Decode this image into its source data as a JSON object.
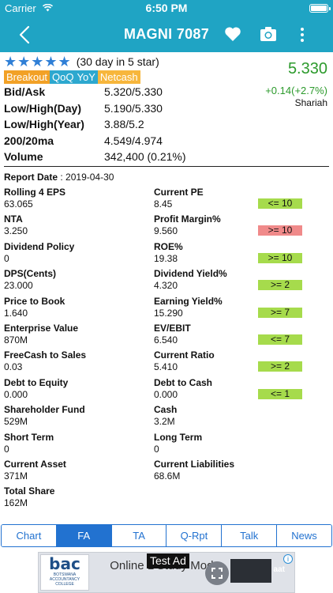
{
  "status_bar": {
    "carrier": "Carrier",
    "time": "6:50 PM"
  },
  "nav": {
    "title": "MAGNI 7087"
  },
  "rating": {
    "stars": "★★★★★",
    "note": "(30 day in 5 star)"
  },
  "tags": [
    "Breakout",
    "QoQ",
    "YoY",
    "Netcash"
  ],
  "price": {
    "last": "5.330",
    "change": "+0.14(+2.7%)",
    "shariah": "Shariah",
    "color": "#2c9a2c"
  },
  "quote": [
    {
      "label": "Bid/Ask",
      "value": "5.320/5.330"
    },
    {
      "label": "Low/High(Day)",
      "value": "5.190/5.330"
    },
    {
      "label": "Low/High(Year)",
      "value": "3.88/5.2"
    },
    {
      "label": "200/20ma",
      "value": "4.549/4.974"
    },
    {
      "label": "Volume",
      "value": "342,400 (0.21%)"
    }
  ],
  "report": {
    "label": "Report Date",
    "separator": ":",
    "date": "2019-04-30"
  },
  "fa": [
    {
      "left": {
        "label": "Rolling 4 EPS",
        "value": "63.065"
      },
      "right": {
        "label": "Current PE",
        "value": "8.45"
      },
      "badge": {
        "text": "<= 10",
        "status": "good"
      }
    },
    {
      "left": {
        "label": "NTA",
        "value": "3.250"
      },
      "right": {
        "label": "Profit Margin%",
        "value": "9.560"
      },
      "badge": {
        "text": ">= 10",
        "status": "bad"
      }
    },
    {
      "left": {
        "label": "Dividend Policy",
        "value": "0"
      },
      "right": {
        "label": "ROE%",
        "value": "19.38"
      },
      "badge": {
        "text": ">= 10",
        "status": "good"
      }
    },
    {
      "left": {
        "label": "DPS(Cents)",
        "value": "23.000"
      },
      "right": {
        "label": "Dividend Yield%",
        "value": "4.320"
      },
      "badge": {
        "text": ">= 2",
        "status": "good"
      }
    },
    {
      "left": {
        "label": "Price to Book",
        "value": "1.640"
      },
      "right": {
        "label": "Earning Yield%",
        "value": "15.290"
      },
      "badge": {
        "text": ">= 7",
        "status": "good"
      }
    },
    {
      "left": {
        "label": "Enterprise Value",
        "value": "870M"
      },
      "right": {
        "label": "EV/EBIT",
        "value": "6.540"
      },
      "badge": {
        "text": "<= 7",
        "status": "good"
      }
    },
    {
      "left": {
        "label": "FreeCash to Sales",
        "value": "0.03"
      },
      "right": {
        "label": "Current Ratio",
        "value": "5.410"
      },
      "badge": {
        "text": ">= 2",
        "status": "good"
      }
    },
    {
      "left": {
        "label": "Debt to Equity",
        "value": "0.000"
      },
      "right": {
        "label": "Debt to Cash",
        "value": "0.000"
      },
      "badge": {
        "text": "<= 1",
        "status": "good"
      }
    },
    {
      "left": {
        "label": "Shareholder Fund",
        "value": "529M"
      },
      "right": {
        "label": "Cash",
        "value": "3.2M"
      },
      "badge": null
    },
    {
      "left": {
        "label": "Short Term",
        "value": "0"
      },
      "right": {
        "label": "Long Term",
        "value": "0"
      },
      "badge": null
    },
    {
      "left": {
        "label": "Current Asset",
        "value": "371M"
      },
      "right": {
        "label": "Current Liabilities",
        "value": "68.6M"
      },
      "badge": null
    },
    {
      "left": {
        "label": "Total Share",
        "value": "162M"
      },
      "right": null,
      "badge": null
    }
  ],
  "tabs": [
    {
      "label": "Chart",
      "active": false
    },
    {
      "label": "FA",
      "active": true
    },
    {
      "label": "TA",
      "active": false
    },
    {
      "label": "Q-Rpt",
      "active": false
    },
    {
      "label": "Talk",
      "active": false
    },
    {
      "label": "News",
      "active": false
    }
  ],
  "ad": {
    "logo_big": "bac",
    "logo_small_1": "BOTSWANA",
    "logo_small_2": "ACCOUNTANCY",
    "logo_small_3": "COLLEGE",
    "text": "Online L Study Mode",
    "label": "Test Ad",
    "brand": "aat",
    "info": "i"
  },
  "colors": {
    "nav_bg": "#1fa4c4",
    "tab_accent": "#2272d0",
    "badge_good": "#a6db4c",
    "badge_bad": "#f08a8a",
    "star": "#2f7fd6"
  }
}
